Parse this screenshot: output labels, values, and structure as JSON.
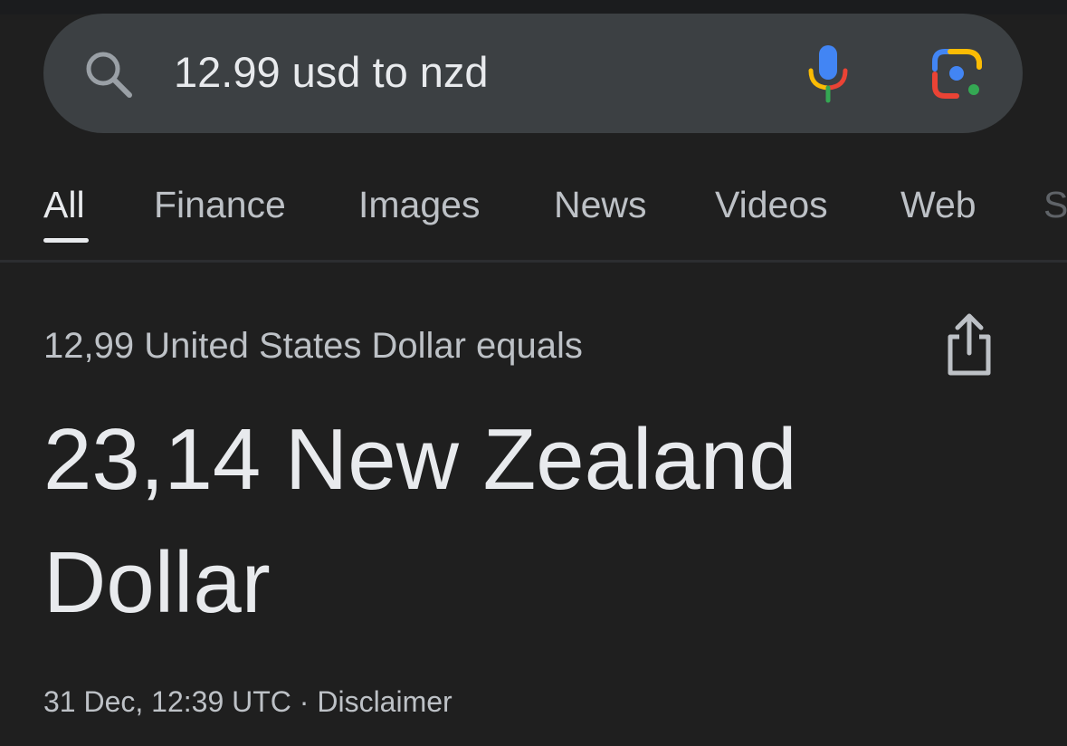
{
  "search": {
    "query": "12.99 usd to nzd"
  },
  "tabs": [
    {
      "label": "All",
      "active": true
    },
    {
      "label": "Finance"
    },
    {
      "label": "Images"
    },
    {
      "label": "News"
    },
    {
      "label": "Videos"
    },
    {
      "label": "Web"
    },
    {
      "label": "S"
    }
  ],
  "conversion": {
    "equals_text": "12,99 United States Dollar equals",
    "result_text": "23,14 New Zealand Dollar",
    "timestamp": "31 Dec, 12:39 UTC",
    "separator": "·",
    "disclaimer": "Disclaimer"
  },
  "icons": {
    "search": "search-icon",
    "mic": "microphone-icon",
    "lens": "google-lens-icon",
    "share": "share-icon"
  },
  "colors": {
    "background": "#1f1f1f",
    "searchbar": "#3c4043",
    "text_primary": "#e8eaed",
    "text_secondary": "#bdc1c6",
    "google_blue": "#4285f4",
    "google_red": "#ea4335",
    "google_yellow": "#fbbc04",
    "google_green": "#34a853"
  }
}
